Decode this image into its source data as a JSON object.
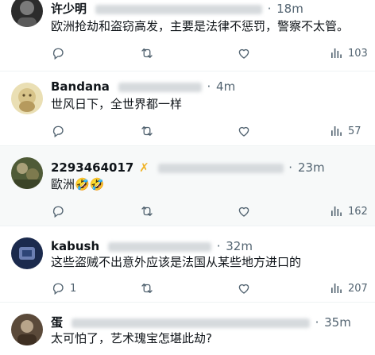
{
  "tweets": [
    {
      "name": "许少明",
      "time": "18m",
      "text": "欧洲抢劫和盗窃高发，主要是法律不惩罚，警察不太管。",
      "reply_count": "",
      "views": "103",
      "avatar_colors": [
        "#2c2c2c",
        "#7a7a7a"
      ]
    },
    {
      "name": "Bandana",
      "time": "4m",
      "text": "世风日下，全世界都一样",
      "reply_count": "",
      "views": "57",
      "avatar_colors": [
        "#eadfb4",
        "#b69a5d"
      ]
    },
    {
      "name": "2293464017",
      "time": "23m",
      "text": "歐洲🤣🤣",
      "reply_count": "",
      "views": "162",
      "avatar_colors": [
        "#4f5b37",
        "#a9a079"
      ]
    },
    {
      "name": "kabush",
      "time": "32m",
      "text": "这些盗贼不出意外应该是法国从某些地方进口的",
      "reply_count": "1",
      "views": "207",
      "avatar_colors": [
        "#1b2a4d",
        "#6c7fb2"
      ]
    },
    {
      "name": "蛋",
      "time": "35m",
      "text": "太可怕了，艺术瑰宝怎堪此劫?",
      "reply_count": "",
      "views": "",
      "avatar_colors": [
        "#5b4a3a",
        "#b8a48a"
      ]
    }
  ],
  "icons": {
    "reply": "reply-icon",
    "retweet": "retweet-icon",
    "like": "heart-icon",
    "views": "views-bar-chart-icon"
  },
  "colors": {
    "muted": "#536471",
    "text": "#0f1419",
    "highlight_bg": "#f7f9f9"
  }
}
